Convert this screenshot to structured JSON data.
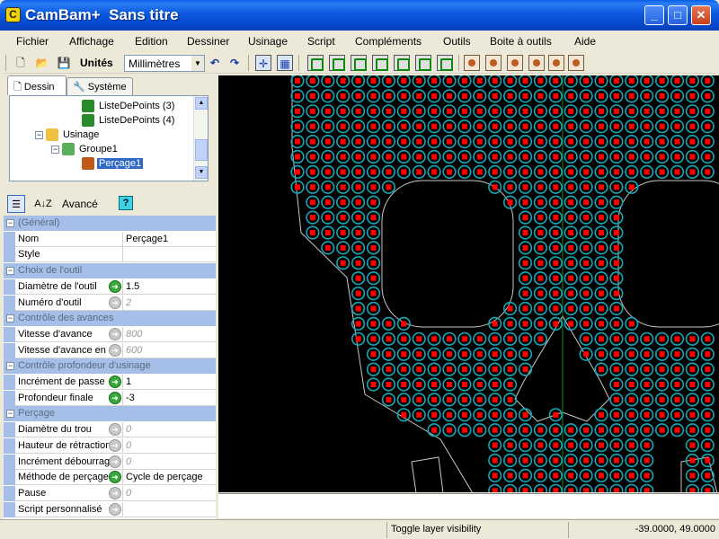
{
  "window": {
    "app_name": "CamBam+",
    "doc_title": "Sans titre",
    "minimize_label": "_",
    "maximize_label": "□",
    "close_label": "✕"
  },
  "menu": {
    "items": [
      "Fichier",
      "Affichage",
      "Edition",
      "Dessiner",
      "Usinage",
      "Script",
      "Compléments",
      "Outils",
      "Boite à outils",
      "Aide"
    ]
  },
  "toolbar": {
    "units_label": "Unités",
    "units_value": "Millimètres"
  },
  "tabs": {
    "dessin": "Dessin",
    "systeme": "Système"
  },
  "tree": {
    "items": [
      {
        "label": "ListeDePoints (3)",
        "icon": "points-list-icon"
      },
      {
        "label": "ListeDePoints (4)",
        "icon": "points-list-icon"
      },
      {
        "label": "Usinage",
        "icon": "folder-icon"
      },
      {
        "label": "Groupe1",
        "icon": "group-icon"
      },
      {
        "label": "Perçage1",
        "icon": "drill-icon"
      }
    ]
  },
  "propbar": {
    "sort_icon": "A↓Z",
    "avance_label": "Avancé",
    "help_label": "?"
  },
  "grid": {
    "rows": [
      {
        "type": "cat",
        "label": "(Général)"
      },
      {
        "type": "prop",
        "name": "Nom",
        "value": "Perçage1",
        "arrow": "none",
        "dim": false
      },
      {
        "type": "prop",
        "name": "Style",
        "value": "",
        "arrow": "none",
        "dim": false
      },
      {
        "type": "cat",
        "label": "Choix de l'outil"
      },
      {
        "type": "prop",
        "name": "Diamètre de l'outil",
        "value": "1.5",
        "arrow": "green",
        "dim": false
      },
      {
        "type": "prop",
        "name": "Numéro d'outil",
        "value": "2",
        "arrow": "gray",
        "dim": true
      },
      {
        "type": "cat",
        "label": "Contrôle des avances"
      },
      {
        "type": "prop",
        "name": "Vitesse d'avance",
        "value": "800",
        "arrow": "gray",
        "dim": true
      },
      {
        "type": "prop",
        "name": "Vitesse d'avance en",
        "value": "600",
        "arrow": "gray",
        "dim": true
      },
      {
        "type": "cat",
        "label": "Contrôle profondeur d'usinage"
      },
      {
        "type": "prop",
        "name": "Incrément de passe",
        "value": "1",
        "arrow": "green",
        "dim": false
      },
      {
        "type": "prop",
        "name": "Profondeur finale",
        "value": "-3",
        "arrow": "green",
        "dim": false
      },
      {
        "type": "cat",
        "label": "Perçage"
      },
      {
        "type": "prop",
        "name": "Diamètre du trou",
        "value": "0",
        "arrow": "gray",
        "dim": true
      },
      {
        "type": "prop",
        "name": "Hauteur de rétraction",
        "value": "0",
        "arrow": "gray",
        "dim": true
      },
      {
        "type": "prop",
        "name": "Incrément débourrage",
        "value": "0",
        "arrow": "gray",
        "dim": true
      },
      {
        "type": "prop",
        "name": "Méthode de perçage",
        "value": "Cycle de perçage",
        "arrow": "green",
        "dim": false
      },
      {
        "type": "prop",
        "name": "Pause",
        "value": "0",
        "arrow": "gray",
        "dim": true
      },
      {
        "type": "prop",
        "name": "Script personnalisé",
        "value": "",
        "arrow": "gray",
        "dim": false
      }
    ]
  },
  "status": {
    "message": "Toggle layer visibility",
    "coordinates": "-39.0000, 49.0000"
  },
  "colors": {
    "canvas_bg": "#000000",
    "hole_fill": "#ff0000",
    "hole_ring": "#1aa7b5",
    "outline": "#c8c8c8",
    "center_line": "#1a8a1a"
  }
}
